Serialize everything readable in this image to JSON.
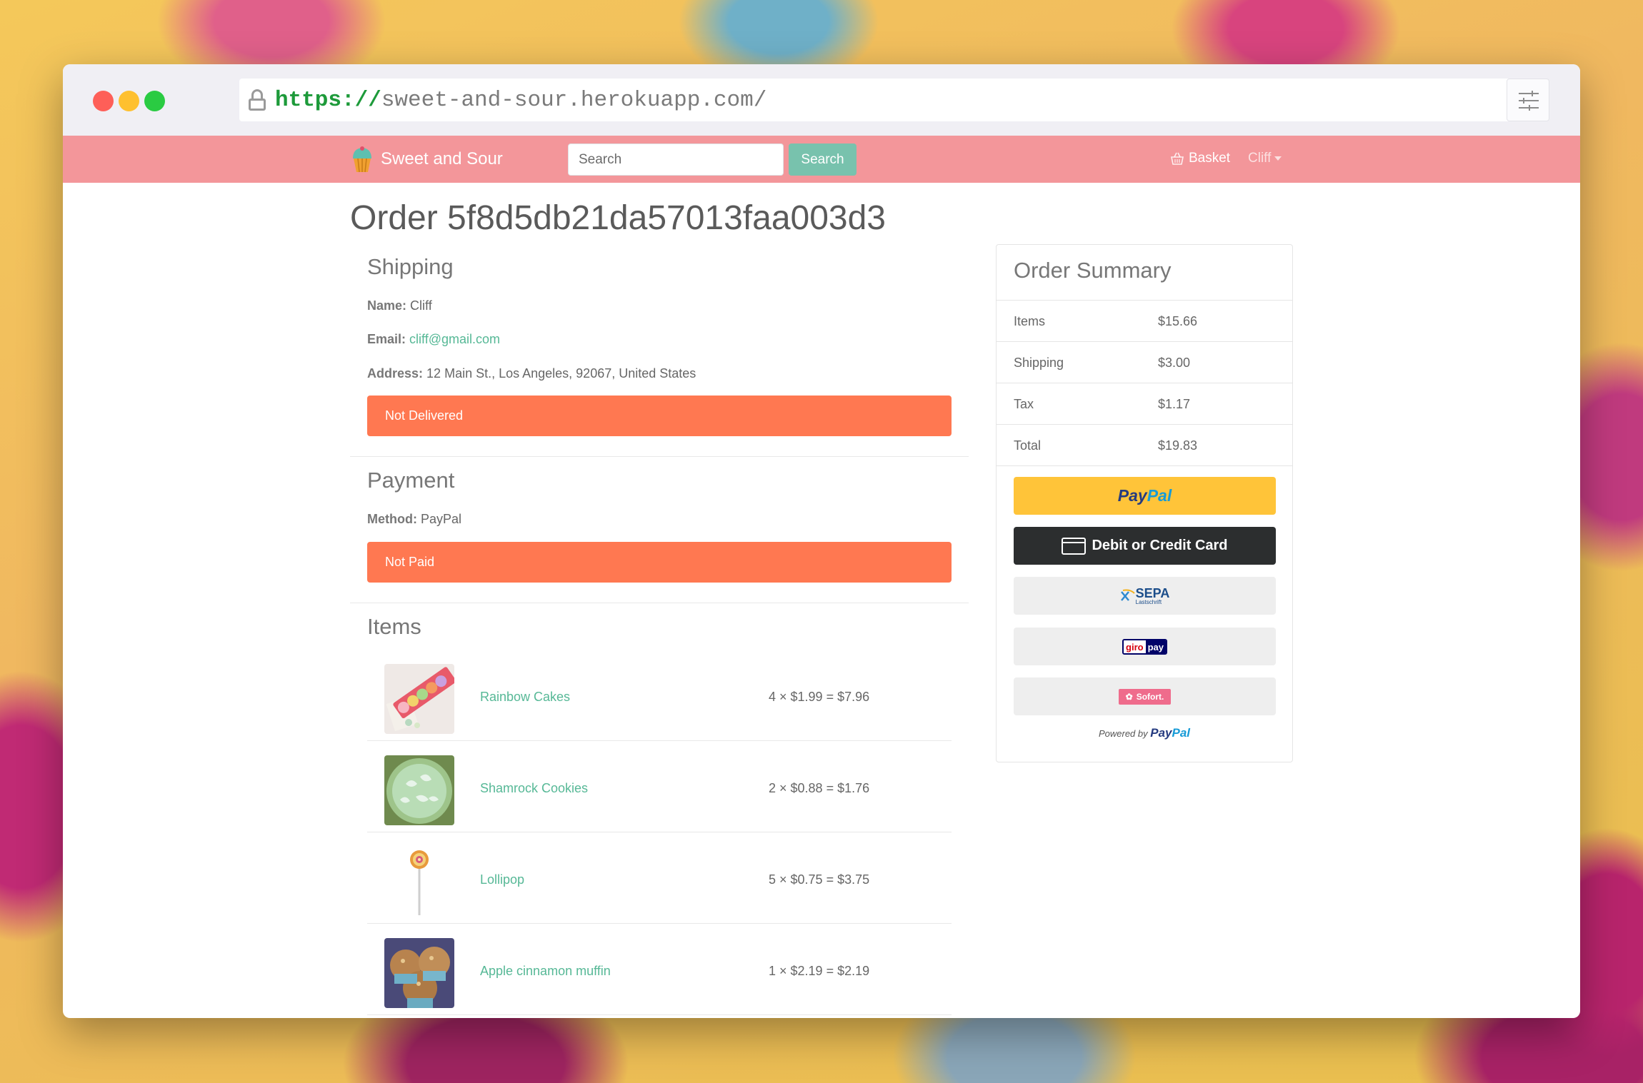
{
  "browser": {
    "url_protocol": "https://",
    "url_host": "sweet-and-sour.herokuapp.com/"
  },
  "navbar": {
    "brand": "Sweet and Sour",
    "search_placeholder": "Search",
    "search_button": "Search",
    "basket": "Basket",
    "user": "Cliff"
  },
  "page": {
    "title": "Order 5f8d5db21da57013faa003d3"
  },
  "shipping": {
    "heading": "Shipping",
    "name_label": "Name:",
    "name": "Cliff",
    "email_label": "Email:",
    "email": "cliff@gmail.com",
    "address_label": "Address:",
    "address": "12 Main St., Los Angeles, 92067, United States",
    "status": "Not Delivered"
  },
  "payment": {
    "heading": "Payment",
    "method_label": "Method:",
    "method": "PayPal",
    "status": "Not Paid"
  },
  "items": {
    "heading": "Items",
    "list": [
      {
        "name": "Rainbow Cakes",
        "calc": "4 × $1.99 = $7.96"
      },
      {
        "name": "Shamrock Cookies",
        "calc": "2 × $0.88 = $1.76"
      },
      {
        "name": "Lollipop",
        "calc": "5 × $0.75 = $3.75"
      },
      {
        "name": "Apple cinnamon muffin",
        "calc": "1 × $2.19 = $2.19"
      }
    ]
  },
  "summary": {
    "heading": "Order Summary",
    "rows": [
      {
        "label": "Items",
        "value": "$15.66"
      },
      {
        "label": "Shipping",
        "value": "$3.00"
      },
      {
        "label": "Tax",
        "value": "$1.17"
      },
      {
        "label": "Total",
        "value": "$19.83"
      }
    ],
    "paypal_pay": "Pay",
    "paypal_pal": "Pal",
    "card_button": "Debit or Credit Card",
    "sepa": "SEPA",
    "sepa_sub": "Lastschrift",
    "giro": "giro",
    "giro_pay": "pay",
    "sofort": "Sofort.",
    "powered_by": "Powered by"
  },
  "colors": {
    "navbar": "#f3969a",
    "accent": "#78c2ad",
    "link": "#56b896",
    "alert": "#ff7851",
    "paypal_yellow": "#ffc439"
  }
}
